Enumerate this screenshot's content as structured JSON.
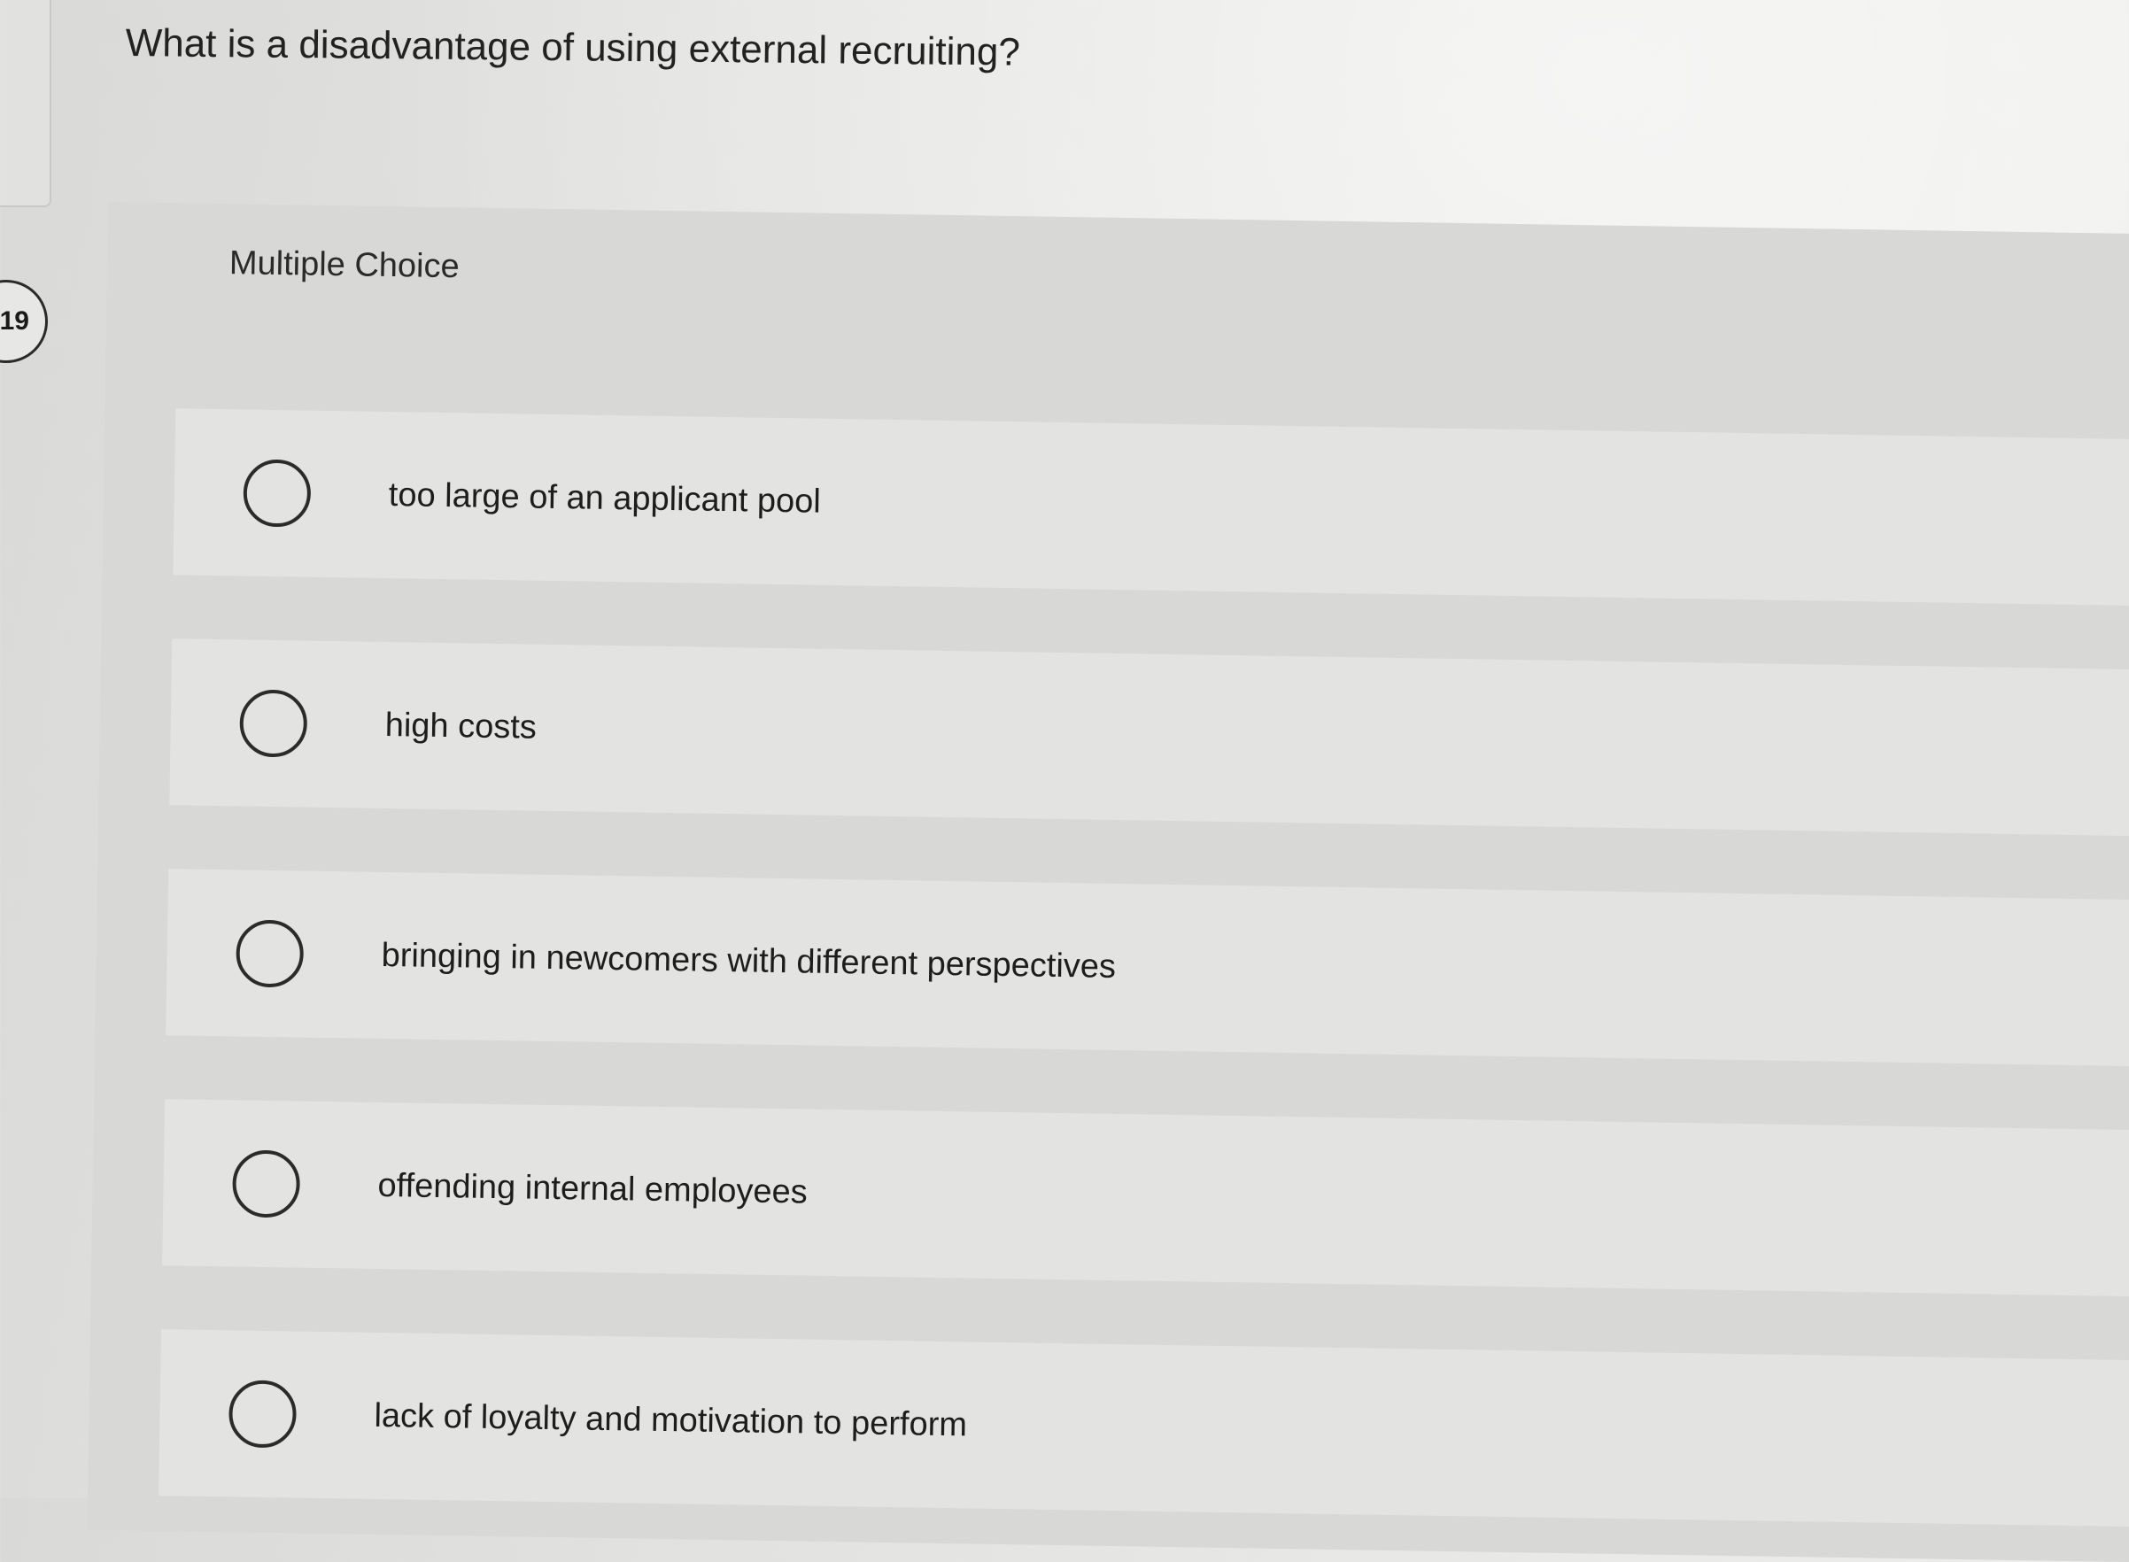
{
  "question": {
    "number": "19",
    "text": "What is a disadvantage of using external recruiting?",
    "type_label": "Multiple Choice"
  },
  "options": [
    {
      "label": "too large of an applicant pool",
      "selected": false
    },
    {
      "label": "high costs",
      "selected": false
    },
    {
      "label": "bringing in newcomers with different perspectives",
      "selected": false
    },
    {
      "label": "offending internal employees",
      "selected": false
    },
    {
      "label": "lack of loyalty and motivation to perform",
      "selected": false
    }
  ]
}
